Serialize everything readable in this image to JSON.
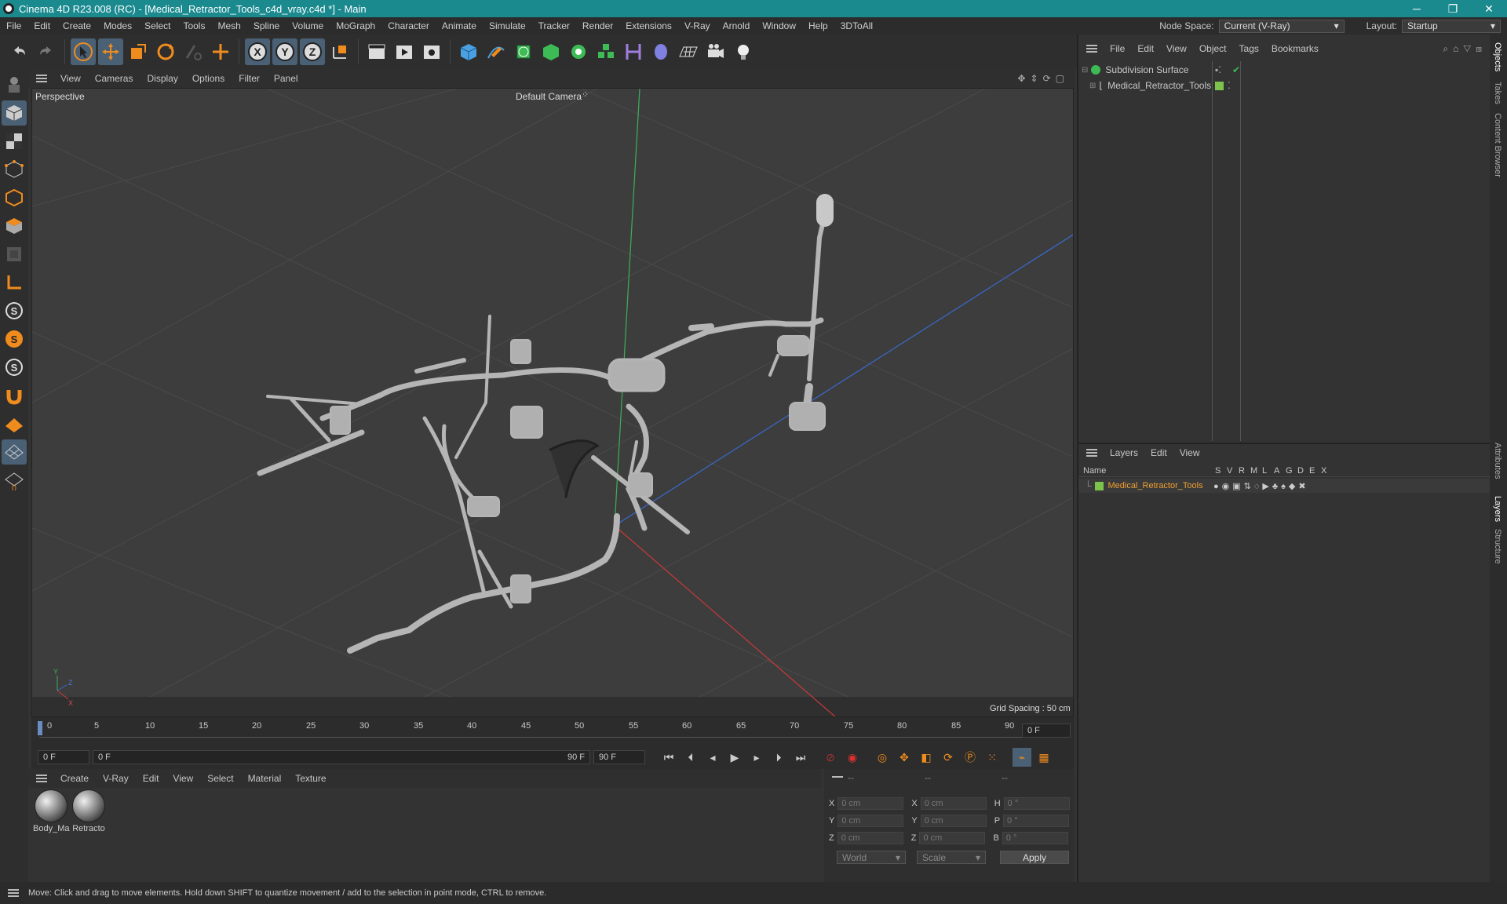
{
  "title": "Cinema 4D R23.008 (RC) - [Medical_Retractor_Tools_c4d_vray.c4d *] - Main",
  "window_controls": {
    "minimize": "─",
    "restore": "❐",
    "close": "✕"
  },
  "menu": [
    "File",
    "Edit",
    "Create",
    "Modes",
    "Select",
    "Tools",
    "Mesh",
    "Spline",
    "Volume",
    "MoGraph",
    "Character",
    "Animate",
    "Simulate",
    "Tracker",
    "Render",
    "Extensions",
    "V-Ray",
    "Arnold",
    "Window",
    "Help",
    "3DToAll"
  ],
  "node_space": {
    "label": "Node Space:",
    "value": "Current (V-Ray)"
  },
  "layout": {
    "label": "Layout:",
    "value": "Startup"
  },
  "viewport_menu": [
    "View",
    "Cameras",
    "Display",
    "Options",
    "Filter",
    "Panel"
  ],
  "viewport": {
    "name": "Perspective",
    "camera": "Default Camera",
    "grid_spacing": "Grid Spacing : 50 cm",
    "axis_y": "Y",
    "axis_z": "Z",
    "axis_x": "X"
  },
  "timeline": {
    "ticks": [
      "0",
      "5",
      "10",
      "15",
      "20",
      "25",
      "30",
      "35",
      "40",
      "45",
      "50",
      "55",
      "60",
      "65",
      "70",
      "75",
      "80",
      "85",
      "90"
    ],
    "current_frame": "0 F"
  },
  "playback": {
    "start": "0 F",
    "range_start": "0 F",
    "range_end": "90 F",
    "end": "90 F"
  },
  "material_menu": [
    "Create",
    "V-Ray",
    "Edit",
    "View",
    "Select",
    "Material",
    "Texture"
  ],
  "materials": [
    {
      "name": "Body_Ma"
    },
    {
      "name": "Retracto"
    }
  ],
  "coords": {
    "headers": [
      "--",
      "--",
      "--"
    ],
    "rows": [
      {
        "a": "X",
        "v1": "0 cm",
        "b": "X",
        "v2": "0 cm",
        "c": "H",
        "v3": "0 °"
      },
      {
        "a": "Y",
        "v1": "0 cm",
        "b": "Y",
        "v2": "0 cm",
        "c": "P",
        "v3": "0 °"
      },
      {
        "a": "Z",
        "v1": "0 cm",
        "b": "Z",
        "v2": "0 cm",
        "c": "B",
        "v3": "0 °"
      }
    ],
    "mode1": "World",
    "mode2": "Scale",
    "apply": "Apply"
  },
  "object_menu": [
    "File",
    "Edit",
    "View",
    "Object",
    "Tags",
    "Bookmarks"
  ],
  "objects": [
    {
      "name": "Subdivision Surface"
    },
    {
      "name": "Medical_Retractor_Tools"
    }
  ],
  "layer_menu": [
    "Layers",
    "Edit",
    "View"
  ],
  "layer_columns": {
    "name": "Name",
    "flags": [
      "S",
      "V",
      "R",
      "M",
      "L",
      "A",
      "G",
      "D",
      "E",
      "X"
    ]
  },
  "layers": [
    {
      "name": "Medical_Retractor_Tools",
      "color": "#7dc24a"
    }
  ],
  "side_tabs": [
    "Objects",
    "Takes",
    "Content Browser",
    "Attributes",
    "Layers",
    "Structure"
  ],
  "status": "Move: Click and drag to move elements. Hold down SHIFT to quantize movement / add to the selection in point mode, CTRL to remove.",
  "colors": {
    "accent": "#1a8a8f",
    "orange": "#f08c1e",
    "selected": "#4a6075",
    "layer_text": "#f0a030"
  }
}
